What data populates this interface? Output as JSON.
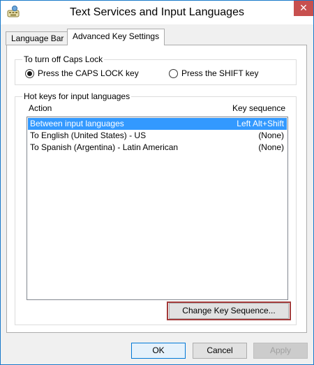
{
  "window": {
    "title": "Text Services and Input Languages",
    "close_glyph": "✕"
  },
  "tabs": [
    {
      "label": "Language Bar",
      "active": false
    },
    {
      "label": "Advanced Key Settings",
      "active": true
    }
  ],
  "caps_lock": {
    "group_label": "To turn off Caps Lock",
    "options": [
      {
        "label": "Press the CAPS LOCK key",
        "selected": true
      },
      {
        "label": "Press the SHIFT key",
        "selected": false
      }
    ]
  },
  "hotkeys": {
    "group_label": "Hot keys for input languages",
    "col_action": "Action",
    "col_key": "Key sequence",
    "rows": [
      {
        "action": "Between input languages",
        "key": "Left Alt+Shift",
        "selected": true
      },
      {
        "action": "To English (United States) - US",
        "key": "(None)",
        "selected": false
      },
      {
        "action": "To Spanish (Argentina) - Latin American",
        "key": "(None)",
        "selected": false
      }
    ],
    "change_button": "Change Key Sequence..."
  },
  "footer": {
    "ok": "OK",
    "cancel": "Cancel",
    "apply": "Apply"
  },
  "colors": {
    "selection": "#3399ff",
    "highlight": "#a33a3a",
    "close": "#c7504f"
  }
}
